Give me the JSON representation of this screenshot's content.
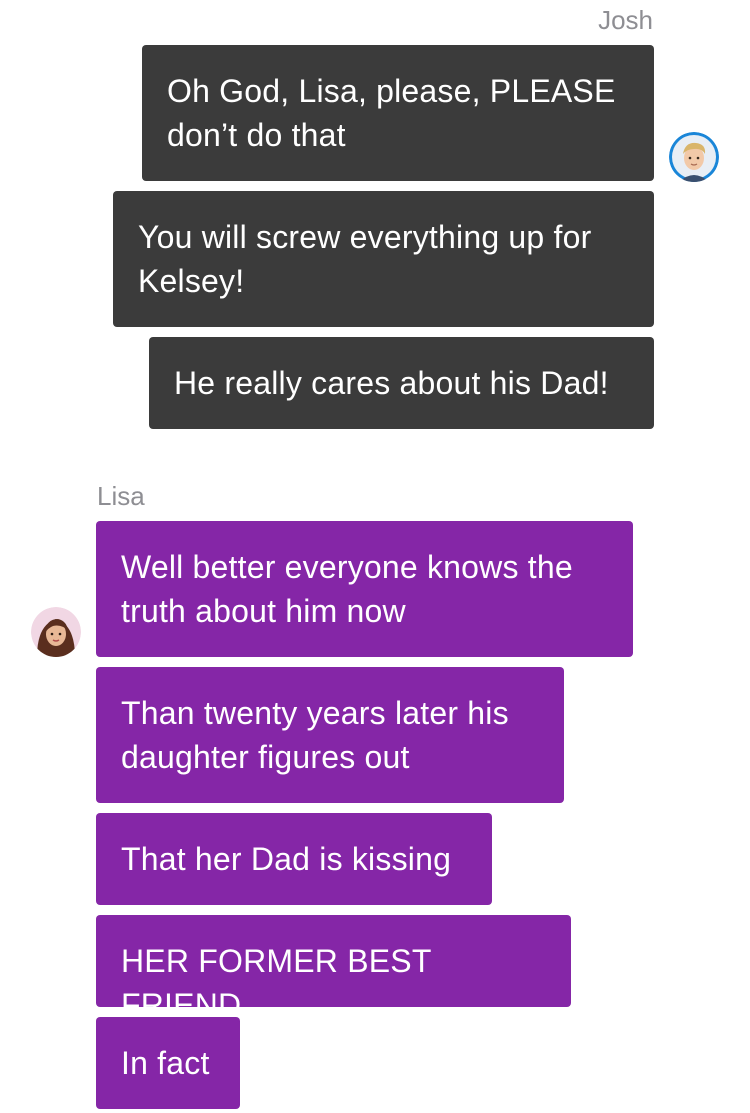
{
  "conversation": {
    "outgoing": {
      "sender": "Josh",
      "avatar_icon": "josh-avatar",
      "bubble_color": "#3b3b3b",
      "messages": [
        "Oh God, Lisa, please, PLEASE don’t do that",
        "You will screw everything up for Kelsey!",
        "He really cares about his Dad!"
      ]
    },
    "incoming": {
      "sender": "Lisa",
      "avatar_icon": "lisa-avatar",
      "bubble_color": "#8526a7",
      "messages": [
        "Well better everyone knows the truth about him now",
        "Than twenty years later his daughter figures out",
        "That her Dad is kissing",
        "HER FORMER BEST FRIEND",
        "In fact"
      ]
    }
  }
}
